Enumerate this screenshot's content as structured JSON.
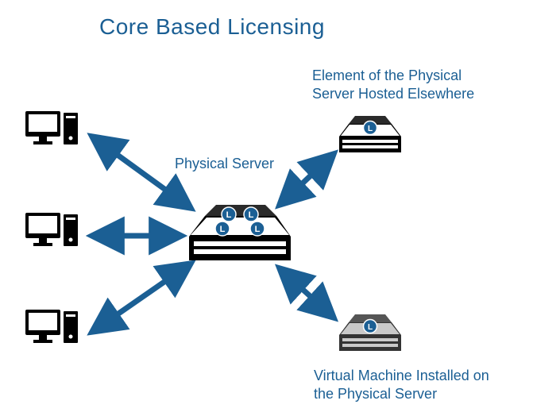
{
  "title": "Core Based Licensing",
  "labels": {
    "physical_server": "Physical Server",
    "element_elsewhere": "Element of the Physical Server Hosted Elsewhere",
    "virtual_machine": "Virtual Machine Installed on the Physical Server"
  },
  "license_badge_letter": "L",
  "colors": {
    "heading": "#1b5f94",
    "arrow": "#1b5f94",
    "badge_fill": "#1b5f94",
    "badge_text": "#ffffff"
  },
  "nodes": {
    "center": {
      "kind": "server",
      "license_count": 4
    },
    "top_right": {
      "kind": "small_server",
      "license_count": 1
    },
    "bottom_right": {
      "kind": "small_server_grey",
      "license_count": 1
    },
    "clients": 3
  }
}
